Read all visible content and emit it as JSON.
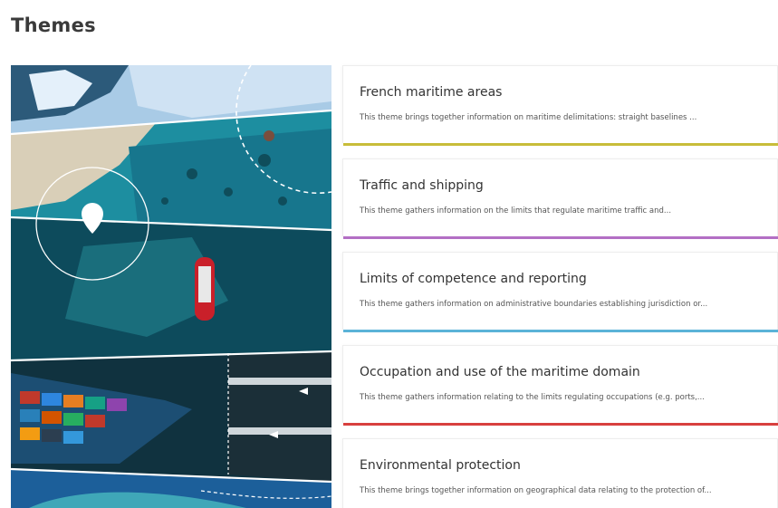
{
  "header": {
    "title": "Themes"
  },
  "hero": {
    "image_name": "maritime-collage-image"
  },
  "themes": [
    {
      "title": "French maritime areas",
      "description": "This theme brings together information on maritime delimitations: straight baselines ...",
      "accent": "#c8bd3a"
    },
    {
      "title": "Traffic and shipping",
      "description": "This theme gathers information on the limits that regulate maritime traffic and...",
      "accent": "#b36fc4"
    },
    {
      "title": "Limits of competence and reporting",
      "description": "This theme gathers information on administrative boundaries establishing jurisdiction or...",
      "accent": "#5bb3d8"
    },
    {
      "title": "Occupation and use of the maritime domain",
      "description": "This theme gathers information relating to the limits regulating occupations (e.g. ports,...",
      "accent": "#d8403e"
    },
    {
      "title": "Environmental protection",
      "description": "This theme brings together information on geographical data relating to the protection of...",
      "accent": "#4aa35a"
    }
  ]
}
